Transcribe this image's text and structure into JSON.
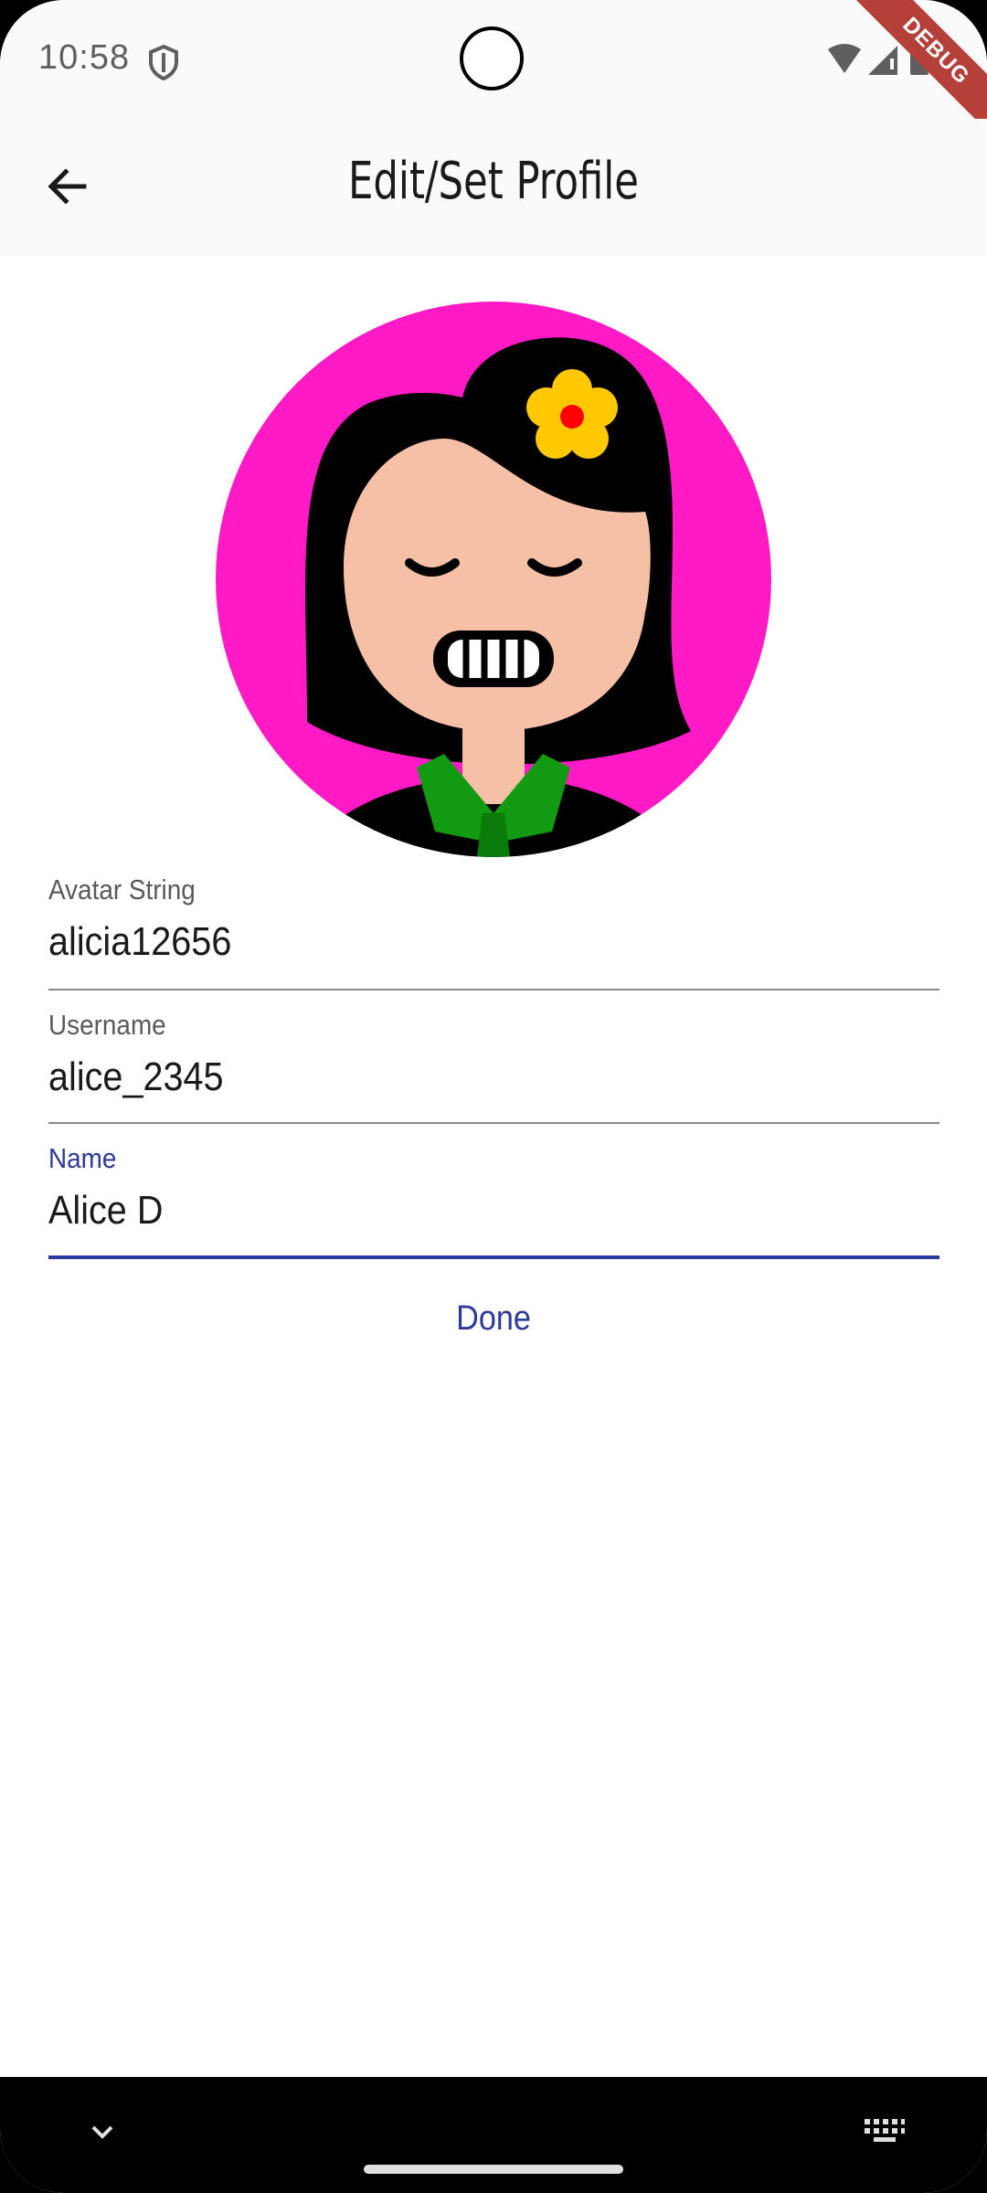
{
  "status_bar": {
    "time": "10:58",
    "debug_label": "DEBUG"
  },
  "app_bar": {
    "title": "Edit/Set Profile",
    "back_icon": "arrow-left-icon"
  },
  "avatar": {
    "background_color": "#ff1ac6",
    "flower_color": "#ffc800"
  },
  "form": {
    "avatar_string": {
      "label": "Avatar String",
      "value": "alicia12656"
    },
    "username": {
      "label": "Username",
      "value": "alice_2345"
    },
    "name": {
      "label": "Name",
      "value": "Alice D"
    },
    "done_label": "Done"
  },
  "colors": {
    "accent": "#2d3a9a",
    "debug_ribbon": "#b5403a"
  }
}
